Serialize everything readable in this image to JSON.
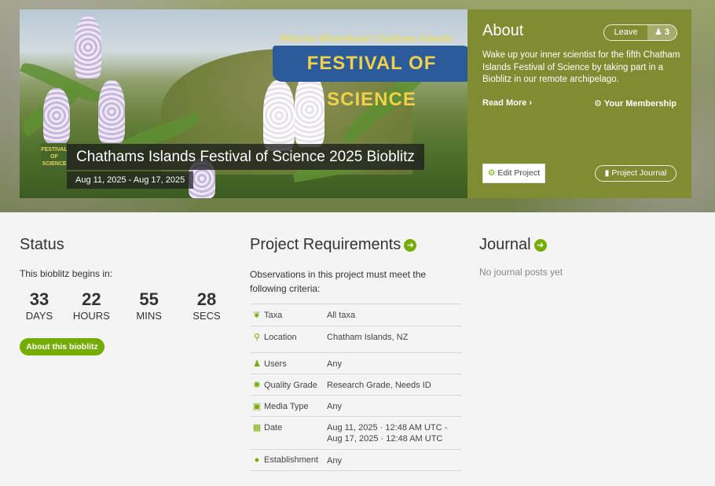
{
  "banner": {
    "festival_subtitle": "Rēkohu Wharekauri Chatham Islands",
    "festival_title": "FESTIVAL OF SCIENCE",
    "logo_text": "FESTIVAL OF SCIENCE",
    "project_title": "Chathams Islands Festival of Science 2025 Bioblitz",
    "dates": "Aug 11, 2025 - Aug 17, 2025"
  },
  "about": {
    "heading": "About",
    "leave_label": "Leave",
    "member_count": "3",
    "description": "Wake up your inner scientist for the fifth Chatham Islands Festival of Science by taking part in a Bioblitz in our remote archipelago.",
    "read_more": "Read More",
    "your_membership": "Your Membership",
    "edit_project": "Edit Project",
    "project_journal": "Project Journal"
  },
  "status": {
    "heading": "Status",
    "begins_text": "This bioblitz begins in:",
    "countdown": [
      {
        "value": "33",
        "unit": "DAYS"
      },
      {
        "value": "22",
        "unit": "HOURS"
      },
      {
        "value": "55",
        "unit": "MINS"
      },
      {
        "value": "28",
        "unit": "SECS"
      }
    ],
    "about_button": "About this bioblitz"
  },
  "requirements": {
    "heading": "Project Requirements",
    "intro": "Observations in this project must meet the following criteria:",
    "rows": [
      {
        "icon": "leaf-icon",
        "label": "Taxa",
        "value": "All taxa"
      },
      {
        "icon": "map-marker-icon",
        "label": "Location",
        "value": "Chatham Islands, NZ"
      },
      {
        "icon": "user-icon",
        "label": "Users",
        "value": "Any"
      },
      {
        "icon": "certificate-icon",
        "label": "Quality Grade",
        "value": "Research Grade, Needs ID"
      },
      {
        "icon": "image-icon",
        "label": "Media Type",
        "value": "Any"
      },
      {
        "icon": "calendar-icon",
        "label": "Date",
        "value": "Aug 11, 2025 · 12:48 AM UTC - Aug 17, 2025 · 12:48 AM UTC"
      },
      {
        "icon": "globe-icon",
        "label": "Establishment",
        "value": "Any"
      }
    ]
  },
  "journal": {
    "heading": "Journal",
    "empty_text": "No journal posts yet"
  },
  "colors": {
    "accent_green": "#74ac00",
    "about_panel": "#7f8c32",
    "festival_blue": "#2c5b9b",
    "festival_yellow": "#f1d04a"
  }
}
